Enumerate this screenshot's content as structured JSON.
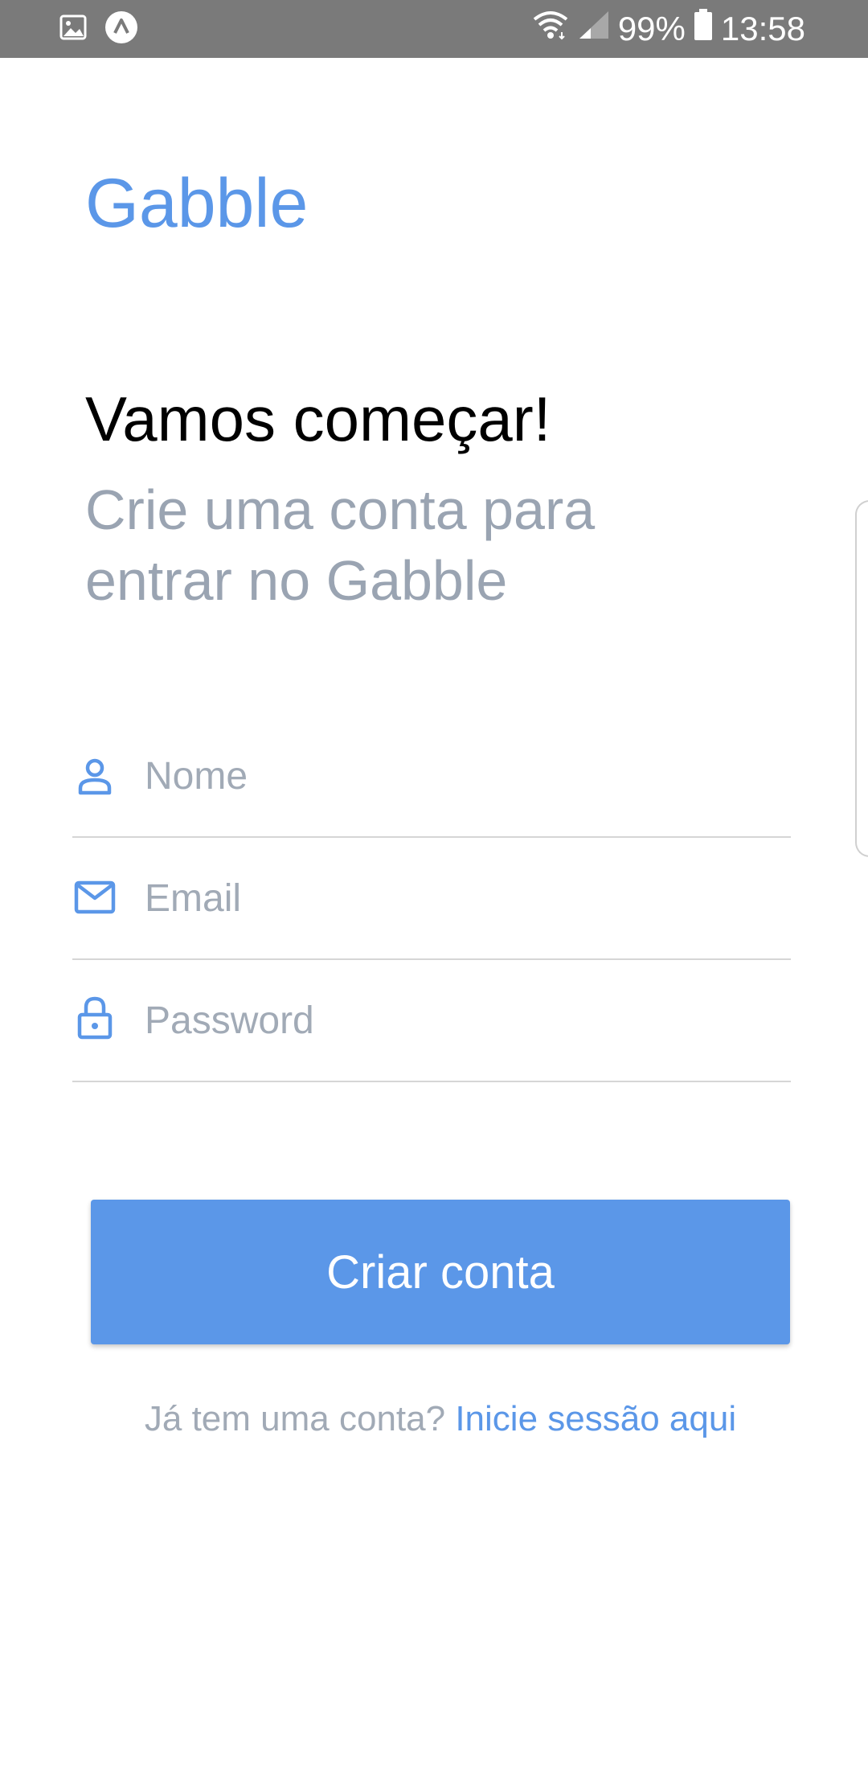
{
  "status_bar": {
    "battery_percent": "99%",
    "time": "13:58",
    "left_icons": [
      "gallery-icon",
      "app-notification-icon"
    ],
    "right_icons": [
      "wifi-icon",
      "signal-icon",
      "battery-icon"
    ]
  },
  "app": {
    "title": "Gabble"
  },
  "intro": {
    "heading": "Vamos começar!",
    "subheading": "Crie uma conta para entrar no Gabble"
  },
  "form": {
    "name": {
      "placeholder": "Nome",
      "icon": "person-icon",
      "value": ""
    },
    "email": {
      "placeholder": "Email",
      "icon": "mail-icon",
      "value": ""
    },
    "password": {
      "placeholder": "Password",
      "icon": "lock-icon",
      "value": ""
    },
    "submit_label": "Criar conta"
  },
  "footer": {
    "prompt": "Já tem uma conta?",
    "link_label": "Inicie sessão aqui"
  },
  "colors": {
    "accent": "#5b97e8",
    "muted_text": "#9aa4b2",
    "status_bar": "#7a7a7a"
  }
}
